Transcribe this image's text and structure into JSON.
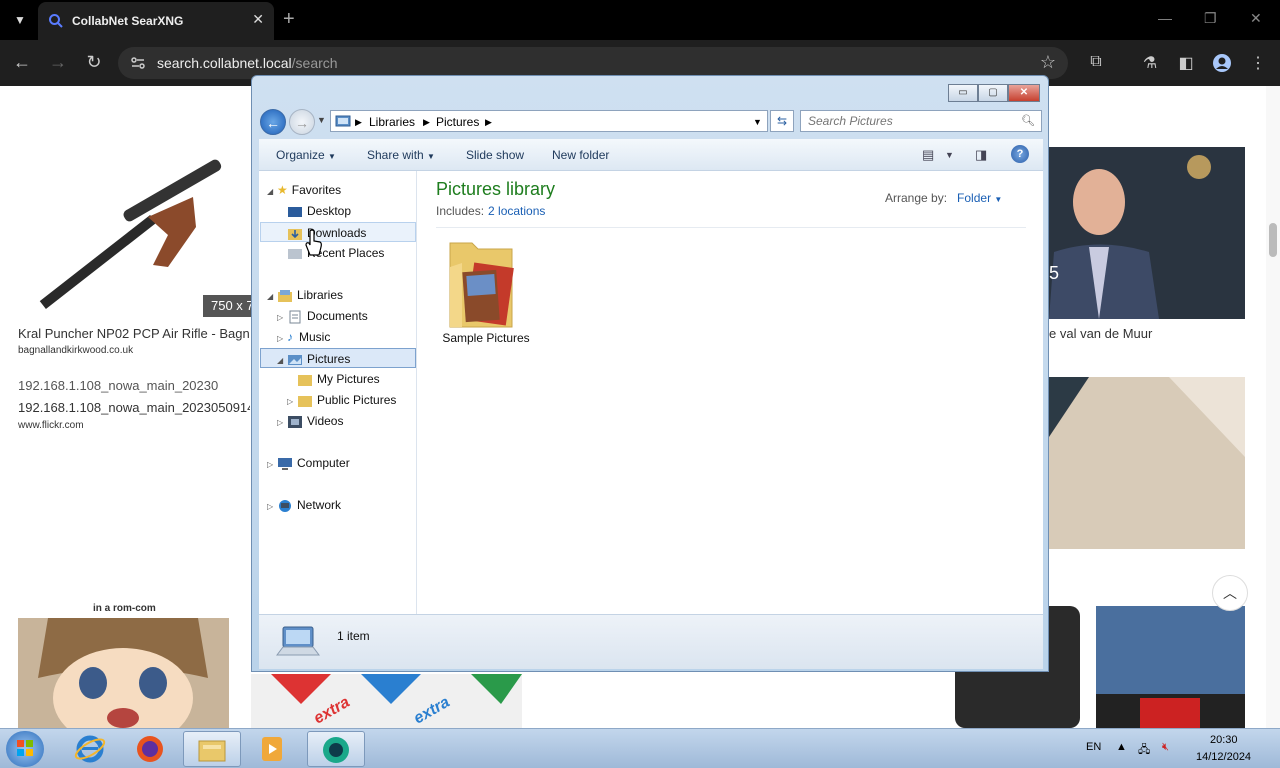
{
  "browser": {
    "tab_title": "CollabNet SearXNG",
    "url_host": "search.collabnet.local",
    "url_path": "/search"
  },
  "page": {
    "size_badge": "750 x 7",
    "results": [
      {
        "title": "Kral Puncher NP02 PCP Air Rifle - Bagn",
        "url": "bagnallandkirkwood.co.uk"
      },
      {
        "title": "192.168.1.108_nowa_main_20230",
        "url": ""
      },
      {
        "title": "192.168.1.108_nowa_main_2023050914",
        "url": "www.flickr.com"
      },
      {
        "title": "e val van de Muur",
        "url": ""
      }
    ],
    "anime_caption": "in a rom-com",
    "extra_text": "extra",
    "tv_number": "5"
  },
  "explorer": {
    "breadcrumb": [
      "Libraries",
      "Pictures"
    ],
    "search_placeholder": "Search Pictures",
    "toolbar": {
      "organize": "Organize",
      "share_with": "Share with",
      "slide_show": "Slide show",
      "new_folder": "New folder"
    },
    "nav": {
      "favorites": "Favorites",
      "desktop": "Desktop",
      "downloads": "Downloads",
      "recent_places": "Recent Places",
      "libraries": "Libraries",
      "documents": "Documents",
      "music": "Music",
      "pictures": "Pictures",
      "my_pictures": "My Pictures",
      "public_pictures": "Public Pictures",
      "videos": "Videos",
      "computer": "Computer",
      "network": "Network"
    },
    "library_title": "Pictures library",
    "includes_label": "Includes:",
    "includes_link": "2 locations",
    "arrange_label": "Arrange by:",
    "arrange_value": "Folder",
    "items": [
      {
        "name": "Sample Pictures"
      }
    ],
    "status_count": "1 item"
  },
  "taskbar": {
    "language": "EN",
    "time": "20:30",
    "date": "14/12/2024"
  },
  "colors": {
    "library_title": "#1e7d1e",
    "link": "#1a5fb4",
    "selected_bg": "#dbe8f8"
  }
}
